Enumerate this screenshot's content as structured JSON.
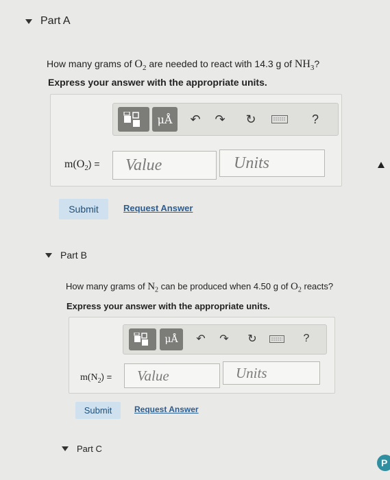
{
  "partA": {
    "header": "Part A",
    "question": {
      "pre": "How many grams of ",
      "species1": "O",
      "species1_sub": "2",
      "mid": " are needed to react with 14.3 g of ",
      "species2": "NH",
      "species2_sub": "3",
      "post": "?"
    },
    "instruction": "Express your answer with the appropriate units.",
    "label_prefix": "m(O",
    "label_sub": "2",
    "label_suffix": ") =",
    "value_placeholder": "Value",
    "units_placeholder": "Units",
    "submit_label": "Submit",
    "request_label": "Request Answer",
    "units_btn": "μÅ",
    "help_btn": "?"
  },
  "partB": {
    "header": "Part B",
    "question": {
      "pre": "How many grams of ",
      "species1": "N",
      "species1_sub": "2",
      "mid": " can be produced when 4.50 g of ",
      "species2": "O",
      "species2_sub": "2",
      "post": " reacts?"
    },
    "instruction": "Express your answer with the appropriate units.",
    "label_prefix": "m(N",
    "label_sub": "2",
    "label_suffix": ") =",
    "value_placeholder": "Value",
    "units_placeholder": "Units",
    "submit_label": "Submit",
    "request_label": "Request Answer",
    "units_btn": "μÅ",
    "help_btn": "?"
  },
  "partC": {
    "header": "Part C"
  },
  "colors": {
    "accent_link": "#2b5d93",
    "submit_bg": "#cfe1ee",
    "toolbar_btn": "#7c7c79",
    "background": "#e9e9e7"
  }
}
